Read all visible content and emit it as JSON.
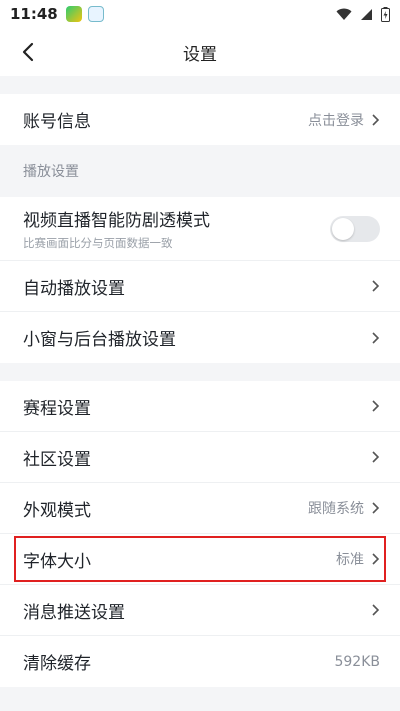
{
  "status": {
    "time": "11:48"
  },
  "nav": {
    "title": "设置"
  },
  "account": {
    "label": "账号信息",
    "value": "点击登录"
  },
  "playback": {
    "header": "播放设置",
    "anti_spoiler": {
      "label": "视频直播智能防剧透模式",
      "sub": "比赛画面比分与页面数据一致",
      "enabled": false
    },
    "autoplay": {
      "label": "自动播放设置"
    },
    "pip": {
      "label": "小窗与后台播放设置"
    }
  },
  "general": {
    "schedule": {
      "label": "赛程设置"
    },
    "community": {
      "label": "社区设置"
    },
    "appearance": {
      "label": "外观模式",
      "value": "跟随系统"
    },
    "font_size": {
      "label": "字体大小",
      "value": "标准"
    },
    "push": {
      "label": "消息推送设置"
    },
    "cache": {
      "label": "清除缓存",
      "value": "592KB"
    }
  }
}
